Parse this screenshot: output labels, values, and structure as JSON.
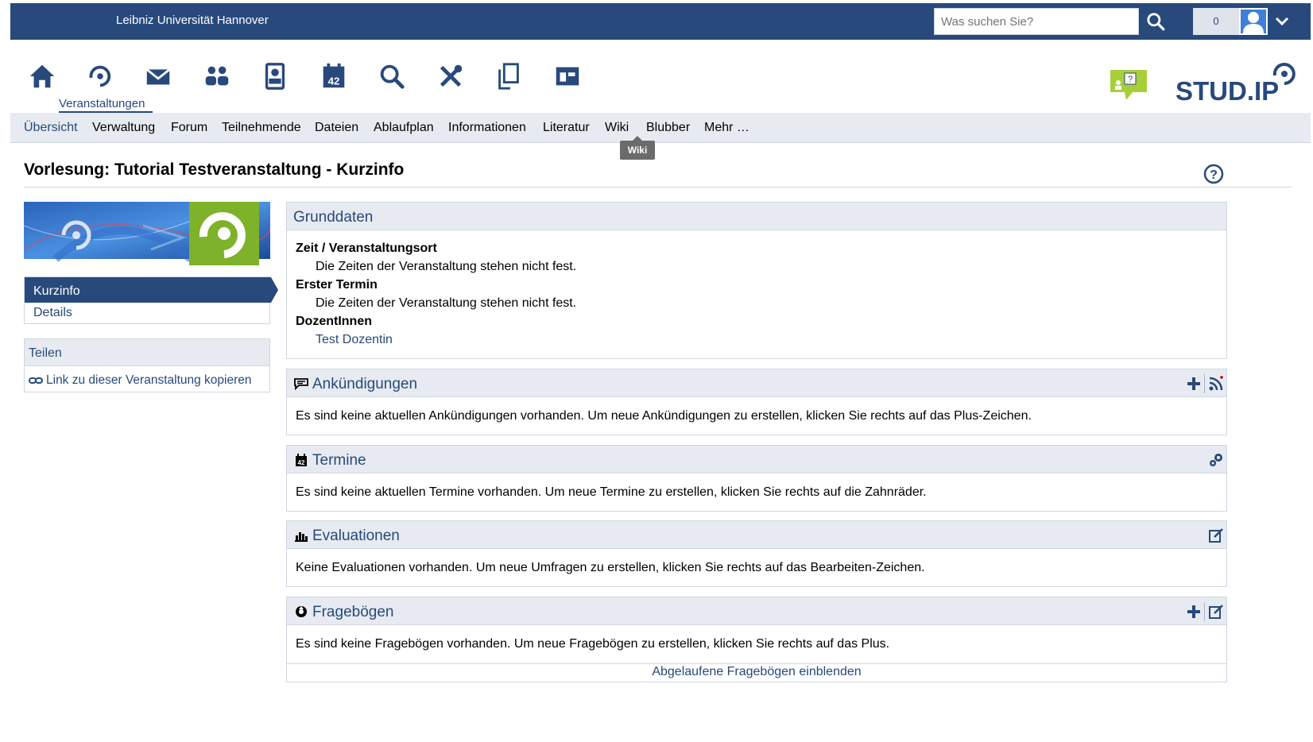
{
  "topbar": {
    "university": "Leibniz Universität Hannover",
    "search_placeholder": "Was suchen Sie?",
    "notification_count": "0"
  },
  "iconnav": {
    "active_label": "Veranstaltungen",
    "icons": [
      "home-icon",
      "courses-icon",
      "messages-icon",
      "community-icon",
      "profile-icon",
      "calendar-icon",
      "search-icon",
      "tools-icon",
      "files-icon",
      "admin-icon"
    ]
  },
  "tabs": [
    {
      "label": "Übersicht"
    },
    {
      "label": "Verwaltung"
    },
    {
      "label": "Forum"
    },
    {
      "label": "Teilnehmende"
    },
    {
      "label": "Dateien"
    },
    {
      "label": "Ablaufplan"
    },
    {
      "label": "Informationen"
    },
    {
      "label": "Literatur"
    },
    {
      "label": "Wiki"
    },
    {
      "label": "Blubber"
    },
    {
      "label": "Mehr …"
    }
  ],
  "tooltip": "Wiki",
  "logo_text": "STUD.IP",
  "page": {
    "title": "Vorlesung: Tutorial Testveranstaltung - Kurzinfo"
  },
  "sidebar": {
    "nav": [
      {
        "label": "Kurzinfo"
      },
      {
        "label": "Details"
      }
    ],
    "share_title": "Teilen",
    "share_link": "Link zu dieser Veranstaltung kopieren"
  },
  "grunddaten": {
    "title": "Grunddaten",
    "rows": [
      {
        "label": "Zeit / Veranstaltungsort",
        "value": "Die Zeiten der Veranstaltung stehen nicht fest."
      },
      {
        "label": "Erster Termin",
        "value": "Die Zeiten der Veranstaltung stehen nicht fest."
      },
      {
        "label": "DozentInnen",
        "value": "Test Dozentin"
      }
    ]
  },
  "announcements": {
    "title": "Ankündigungen",
    "text": "Es sind keine aktuellen Ankündigungen vorhanden. Um neue Ankündigungen zu erstellen, klicken Sie rechts auf das Plus-Zeichen."
  },
  "dates": {
    "title": "Termine",
    "text": "Es sind keine aktuellen Termine vorhanden. Um neue Termine zu erstellen, klicken Sie rechts auf die Zahnräder."
  },
  "evaluations": {
    "title": "Evaluationen",
    "text": "Keine Evaluationen vorhanden. Um neue Umfragen zu erstellen, klicken Sie rechts auf das Bearbeiten-Zeichen."
  },
  "questionnaires": {
    "title": "Fragebögen",
    "text": "Es sind keine Fragebögen vorhanden. Um neue Fragebögen zu erstellen, klicken Sie rechts auf das Plus.",
    "expired_link": "Abgelaufene Fragebögen einblenden"
  },
  "colors": {
    "brand": "#28497c",
    "header_bg": "#e7ebf1",
    "border": "#d0d7e3",
    "logo_green": "#8cbf1f"
  }
}
